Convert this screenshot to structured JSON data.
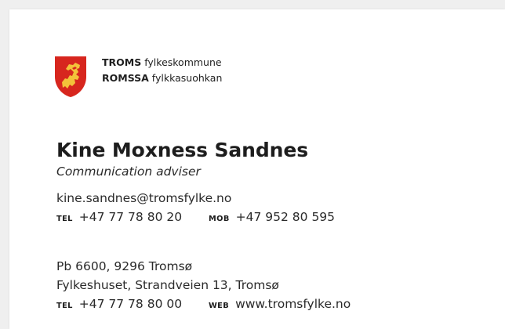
{
  "organization": {
    "line1_bold": "TROMS",
    "line1_rest": "fylkeskommune",
    "line2_bold": "ROMSSA",
    "line2_rest": "fylkkasuohkan"
  },
  "person": {
    "name": "Kine Moxness Sandnes",
    "title": "Communication adviser"
  },
  "contact": {
    "email": "kine.sandnes@tromsfylke.no",
    "tel_label": "TEL",
    "tel": "+47 77 78 80 20",
    "mob_label": "MOB",
    "mob": "+47 952 80 595"
  },
  "office": {
    "postal": "Pb 6600, 9296 Tromsø",
    "street": "Fylkeshuset, Strandveien 13, Tromsø",
    "tel_label": "TEL",
    "tel": "+47 77 78 80 00",
    "web_label": "WEB",
    "web": "www.tromsfylke.no"
  },
  "colors": {
    "shield_red": "#d7261e",
    "griffin_gold": "#f3c23a"
  },
  "icons": {
    "logo": "coat-of-arms-icon"
  }
}
